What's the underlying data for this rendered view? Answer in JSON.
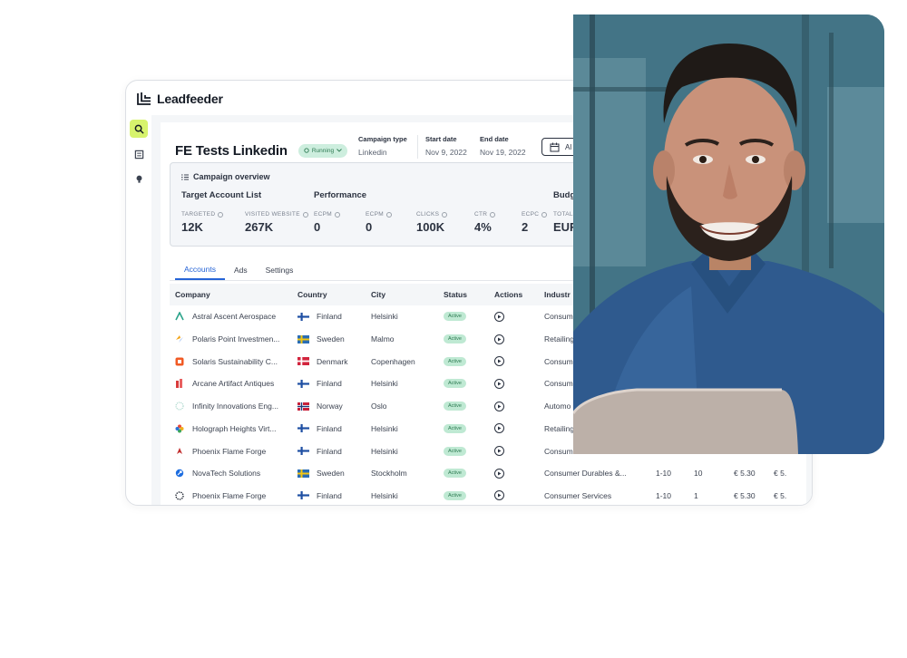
{
  "brand": {
    "name": "Leadfeeder"
  },
  "header": {
    "campaign_title": "FE Tests Linkedin",
    "status": "Running",
    "campaign_type_label": "Campaign type",
    "campaign_type_value": "Linkedin",
    "start_date_label": "Start date",
    "start_date_value": "Nov 9, 2022",
    "end_date_label": "End date",
    "end_date_value": "Nov 19, 2022",
    "date_button": "Al"
  },
  "overview": {
    "title": "Campaign overview",
    "target_section": "Target Account List",
    "performance_section": "Performance",
    "budget_section": "Budg",
    "metrics": [
      {
        "label": "TARGETED",
        "value": "12K"
      },
      {
        "label": "VISITED WEBSITE",
        "value": "267K"
      },
      {
        "label": "ECPM",
        "value": "0"
      },
      {
        "label": "ECPM",
        "value": "0"
      },
      {
        "label": "CLICKS",
        "value": "100K"
      },
      {
        "label": "CTR",
        "value": "4%"
      },
      {
        "label": "ECPC",
        "value": "2"
      },
      {
        "label": "TOTAL",
        "value": "EUR"
      }
    ]
  },
  "tabs": [
    "Accounts",
    "Ads",
    "Settings"
  ],
  "table": {
    "columns": [
      "Company",
      "Country",
      "City",
      "Status",
      "Actions",
      "Industr"
    ],
    "rows": [
      {
        "company": "Astral Ascent Aerospace",
        "icon": "astral-logo-icon",
        "country": "Finland",
        "city": "Helsinki",
        "status": "Active",
        "industry": "Consum",
        "size": "",
        "count": "",
        "cpc": "",
        "extra": ""
      },
      {
        "company": "Polaris Point Investmen...",
        "icon": "polaris-logo-icon",
        "country": "Sweden",
        "city": "Malmo",
        "status": "Active",
        "industry": "Retailing",
        "size": "",
        "count": "",
        "cpc": "",
        "extra": ""
      },
      {
        "company": "Solaris Sustainability C...",
        "icon": "solaris-logo-icon",
        "country": "Denmark",
        "city": "Copenhagen",
        "status": "Active",
        "industry": "Consum",
        "size": "",
        "count": "",
        "cpc": "",
        "extra": ""
      },
      {
        "company": "Arcane Artifact Antiques",
        "icon": "arcane-logo-icon",
        "country": "Finland",
        "city": "Helsinki",
        "status": "Active",
        "industry": "Consum",
        "size": "",
        "count": "",
        "cpc": "",
        "extra": ""
      },
      {
        "company": "Infinity Innovations Eng...",
        "icon": "infinity-logo-icon",
        "country": "Norway",
        "city": "Oslo",
        "status": "Active",
        "industry": "Automo",
        "size": "",
        "count": "",
        "cpc": "",
        "extra": ""
      },
      {
        "company": "Holograph Heights Virt...",
        "icon": "holograph-logo-icon",
        "country": "Finland",
        "city": "Helsinki",
        "status": "Active",
        "industry": "Retailing",
        "size": "",
        "count": "",
        "cpc": "",
        "extra": ""
      },
      {
        "company": "Phoenix Flame Forge",
        "icon": "phoenix-logo-icon",
        "country": "Finland",
        "city": "Helsinki",
        "status": "Active",
        "industry": "Consum",
        "size": "",
        "count": "",
        "cpc": "",
        "extra": ""
      },
      {
        "company": "NovaTech Solutions",
        "icon": "novatech-logo-icon",
        "country": "Sweden",
        "city": "Stockholm",
        "status": "Active",
        "industry": "Consumer Durables &...",
        "size": "1-10",
        "count": "10",
        "cpc": "€ 5.30",
        "extra": "€ 5."
      },
      {
        "company": "Phoenix Flame Forge",
        "icon": "phoenix-ring-logo-icon",
        "country": "Finland",
        "city": "Helsinki",
        "status": "Active",
        "industry": "Consumer Services",
        "size": "1-10",
        "count": "1",
        "cpc": "€ 5.30",
        "extra": "€ 5."
      }
    ]
  },
  "colors": {
    "accent": "#2563d6",
    "nav_active": "#d7f36d",
    "status_bg": "#bfe9d3",
    "status_text": "#2d7a52"
  }
}
